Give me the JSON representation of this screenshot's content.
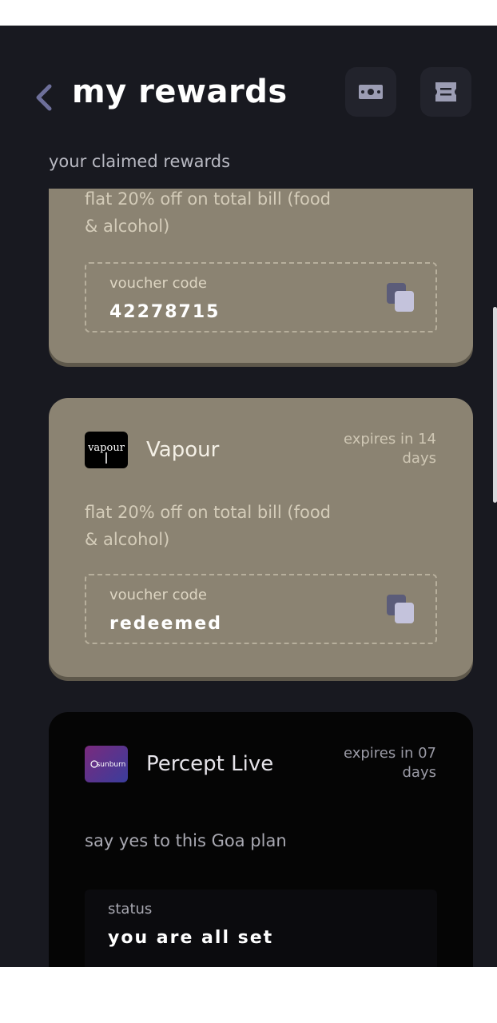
{
  "header": {
    "title": "my rewards",
    "back_icon": "chevron-left-icon",
    "wallet_icon": "cash-icon",
    "ticket_icon": "ticket-icon"
  },
  "subtitle": "your claimed rewards",
  "colors": {
    "background": "#181920",
    "card_khaki": "#8b8372",
    "card_dark": "#050505",
    "accent_back": "#6d6f9a"
  },
  "rewards": [
    {
      "description": "flat 20% off on total bill (food & alcohol)",
      "voucher_label": "voucher code",
      "voucher_value": "42278715"
    },
    {
      "brand": "Vapour",
      "logo_text": "vapour",
      "expiry": "expires in 14 days",
      "description": "flat 20% off on total bill (food & alcohol)",
      "voucher_label": "voucher code",
      "voucher_value": "redeemed"
    },
    {
      "brand": "Percept Live",
      "logo_text": "sunburn",
      "expiry": "expires in 07 days",
      "description": "say yes to this Goa plan",
      "status_label": "status",
      "status_value": "you are all set"
    }
  ]
}
